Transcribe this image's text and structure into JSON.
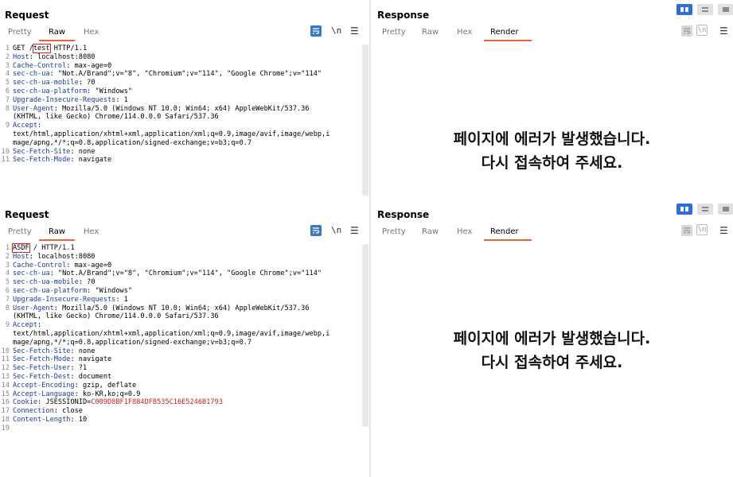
{
  "request_panel": {
    "title": "Request",
    "tabs": [
      "Pretty",
      "Raw",
      "Hex"
    ],
    "active_tab": "Raw",
    "newline_toggle": "\\n",
    "menu_icon": "hamburger-icon"
  },
  "response_panel": {
    "title": "Response",
    "tabs": [
      "Pretty",
      "Raw",
      "Hex",
      "Render"
    ],
    "active_tab": "Render",
    "newline_toggle": "\\n",
    "render_lines": [
      "페이지에 에러가 발생했습니다.",
      "다시 접속하여 주세요."
    ]
  },
  "layout_buttons": [
    "split-vertical-icon",
    "split-horizontal-icon",
    "single-pane-icon"
  ],
  "request1_lines": [
    {
      "n": "1",
      "pre": "GET /",
      "boxed": "test",
      "post": " HTTP/1.1"
    },
    {
      "n": "2",
      "key": "Host",
      "val": ": localhost:8080"
    },
    {
      "n": "3",
      "key": "Cache-Control",
      "val": ": max-age=0"
    },
    {
      "n": "4",
      "key": "sec-ch-ua",
      "val": ": \"Not.A/Brand\";v=\"8\", \"Chromium\";v=\"114\", \"Google Chrome\";v=\"114\""
    },
    {
      "n": "5",
      "key": "sec-ch-ua-mobile",
      "val": ": ?0"
    },
    {
      "n": "6",
      "key": "sec-ch-ua-platform",
      "val": ": \"Windows\""
    },
    {
      "n": "7",
      "key": "Upgrade-Insecure-Requests",
      "val": ": 1"
    },
    {
      "n": "8",
      "key": "User-Agent",
      "val": ": Mozilla/5.0 (Windows NT 10.0; Win64; x64) AppleWebKit/537.36"
    },
    {
      "n": "",
      "val": "(KHTML, like Gecko) Chrome/114.0.0.0 Safari/537.36"
    },
    {
      "n": "9",
      "key": "Accept",
      "val": ":"
    },
    {
      "n": "",
      "val": "text/html,application/xhtml+xml,application/xml;q=0.9,image/avif,image/webp,i"
    },
    {
      "n": "",
      "val": "mage/apng,*/*;q=0.8,application/signed-exchange;v=b3;q=0.7"
    },
    {
      "n": "10",
      "key": "Sec-Fetch-Site",
      "val": ": none"
    },
    {
      "n": "11",
      "key": "Sec-Fetch-Mode",
      "val": ": navigate"
    }
  ],
  "request2_lines": [
    {
      "n": "1",
      "pre": "",
      "boxed": "ASDF",
      "post": " / HTTP/1.1"
    },
    {
      "n": "2",
      "key": "Host",
      "val": ": localhost:8080"
    },
    {
      "n": "3",
      "key": "Cache-Control",
      "val": ": max-age=0"
    },
    {
      "n": "4",
      "key": "sec-ch-ua",
      "val": ": \"Not.A/Brand\";v=\"8\", \"Chromium\";v=\"114\", \"Google Chrome\";v=\"114\""
    },
    {
      "n": "5",
      "key": "sec-ch-ua-mobile",
      "val": ": ?0"
    },
    {
      "n": "6",
      "key": "sec-ch-ua-platform",
      "val": ": \"Windows\""
    },
    {
      "n": "7",
      "key": "Upgrade-Insecure-Requests",
      "val": ": 1"
    },
    {
      "n": "8",
      "key": "User-Agent",
      "val": ": Mozilla/5.0 (Windows NT 10.0; Win64; x64) AppleWebKit/537.36"
    },
    {
      "n": "",
      "val": "(KHTML, like Gecko) Chrome/114.0.0.0 Safari/537.36"
    },
    {
      "n": "9",
      "key": "Accept",
      "val": ":"
    },
    {
      "n": "",
      "val": "text/html,application/xhtml+xml,application/xml;q=0.9,image/avif,image/webp,i"
    },
    {
      "n": "",
      "val": "mage/apng,*/*;q=0.8,application/signed-exchange;v=b3;q=0.7"
    },
    {
      "n": "10",
      "key": "Sec-Fetch-Site",
      "val": ": none"
    },
    {
      "n": "11",
      "key": "Sec-Fetch-Mode",
      "val": ": navigate"
    },
    {
      "n": "12",
      "key": "Sec-Fetch-User",
      "val": ": ?1"
    },
    {
      "n": "13",
      "key": "Sec-Fetch-Dest",
      "val": ": document"
    },
    {
      "n": "14",
      "key": "Accept-Encoding",
      "val": ": gzip, deflate"
    },
    {
      "n": "15",
      "key": "Accept-Language",
      "val": ": ko-KR,ko;q=0.9"
    },
    {
      "n": "16",
      "key": "Cookie",
      "val": ": JSESSIONID=",
      "redval": "C009D8BF1F884DFB535C16E5246B1793"
    },
    {
      "n": "17",
      "key": "Connection",
      "val": ": close"
    },
    {
      "n": "18",
      "key": "Content-Length",
      "val": ": 10"
    },
    {
      "n": "19",
      "val": ""
    }
  ]
}
